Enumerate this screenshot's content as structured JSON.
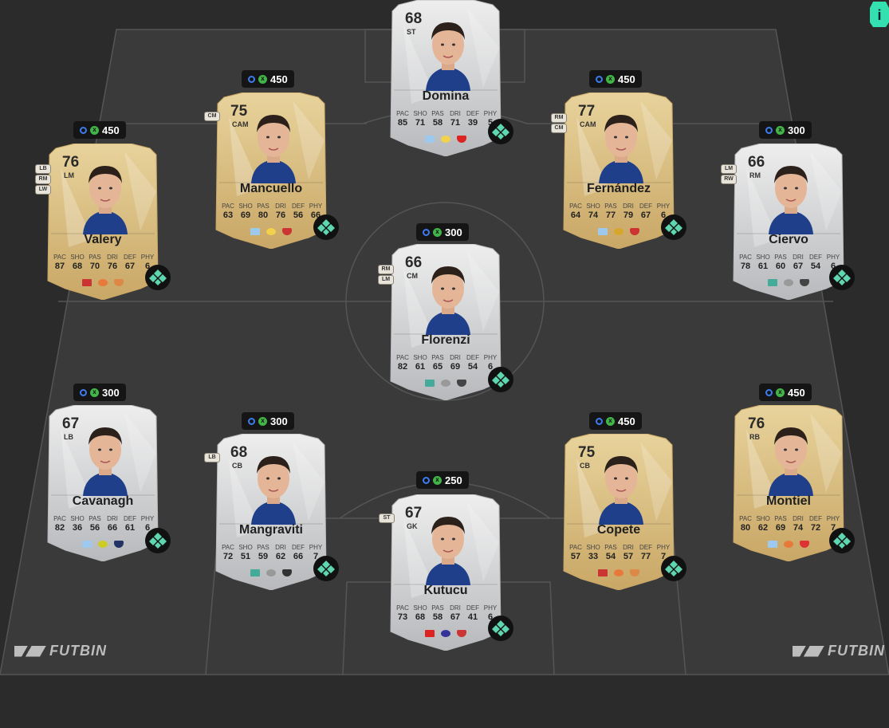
{
  "stat_labels": [
    "PAC",
    "SHO",
    "PAS",
    "DRI",
    "DEF",
    "PHY"
  ],
  "brand": "FUTBIN",
  "info_icon": "i",
  "players": {
    "domina": {
      "rating": "68",
      "pos": "ST",
      "name": "Domina",
      "stats": [
        "85",
        "71",
        "58",
        "71",
        "39",
        "5"
      ],
      "price": ""
    },
    "mancuello": {
      "rating": "75",
      "pos": "CAM",
      "alt": "CM",
      "name": "Mancuello",
      "stats": [
        "63",
        "69",
        "80",
        "76",
        "56",
        "66"
      ],
      "price": "450"
    },
    "fernandez": {
      "rating": "77",
      "pos": "CAM",
      "alt1": "RM",
      "alt2": "CM",
      "name": "Fernández",
      "stats": [
        "64",
        "74",
        "77",
        "79",
        "67",
        "6"
      ],
      "price": "450"
    },
    "valery": {
      "rating": "76",
      "pos": "LM",
      "alt1": "LB",
      "alt2": "RM",
      "alt3": "LW",
      "name": "Valery",
      "stats": [
        "87",
        "68",
        "70",
        "76",
        "67",
        "6"
      ],
      "price": "450"
    },
    "ciervo": {
      "rating": "66",
      "pos": "RM",
      "alt1": "LM",
      "alt2": "RW",
      "name": "Ciervo",
      "stats": [
        "78",
        "61",
        "60",
        "67",
        "54",
        "6"
      ],
      "price": "300"
    },
    "florenzi": {
      "rating": "66",
      "pos": "CM",
      "alt1": "RM",
      "alt2": "LM",
      "name": "Florenzi",
      "stats": [
        "82",
        "61",
        "65",
        "69",
        "54",
        "6"
      ],
      "price": "300"
    },
    "cavanagh": {
      "rating": "67",
      "pos": "LB",
      "name": "Cavanagh",
      "stats": [
        "82",
        "36",
        "56",
        "66",
        "61",
        "6"
      ],
      "price": "300"
    },
    "mangraviti": {
      "rating": "68",
      "pos": "CB",
      "alt": "LB",
      "name": "Mangraviti",
      "stats": [
        "72",
        "51",
        "59",
        "62",
        "66",
        "7"
      ],
      "price": "300"
    },
    "kutucu": {
      "rating": "67",
      "pos": "GK",
      "alt": "ST",
      "name": "Kutucu",
      "stats": [
        "73",
        "68",
        "58",
        "67",
        "41",
        "6"
      ],
      "price": "250"
    },
    "copete": {
      "rating": "75",
      "pos": "CB",
      "name": "Copete",
      "stats": [
        "57",
        "33",
        "54",
        "57",
        "77",
        "7"
      ],
      "price": "450"
    },
    "montiel": {
      "rating": "76",
      "pos": "RB",
      "name": "Montiel",
      "stats": [
        "80",
        "62",
        "69",
        "74",
        "72",
        "7"
      ],
      "price": "450"
    }
  },
  "colors": {
    "gold_top": "#e8d39c",
    "gold_bottom": "#c9a766",
    "silver_top": "#eeeeee",
    "silver_bottom": "#b7b9bc",
    "chem_green": "#5ed6b0",
    "pitch": "#3a3a3a",
    "lines": "#5a5a5a"
  }
}
